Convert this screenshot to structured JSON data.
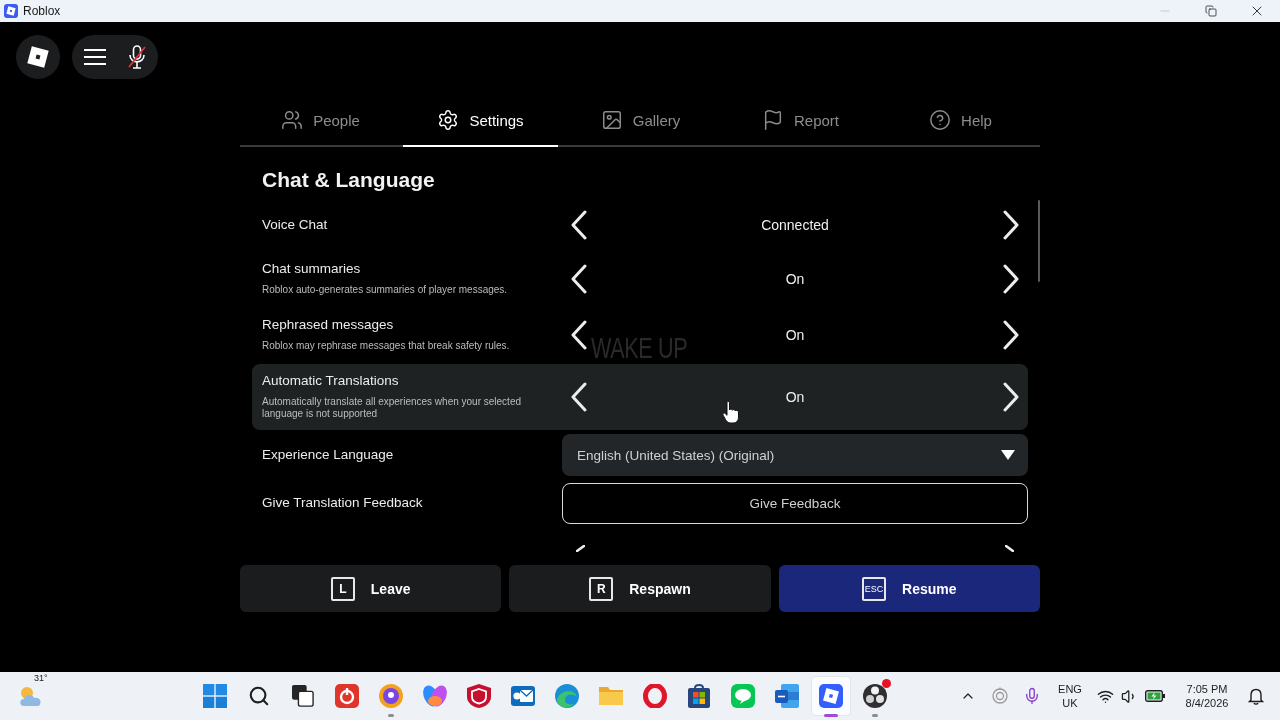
{
  "window": {
    "title": "Roblox",
    "controls": [
      {
        "kind": "minimize",
        "disabled": true
      },
      {
        "kind": "restore",
        "disabled": false
      },
      {
        "kind": "close",
        "disabled": false
      }
    ]
  },
  "voice": {
    "muted": true
  },
  "tabs": [
    {
      "kind": "people",
      "label": "People",
      "selected": false
    },
    {
      "kind": "settings",
      "label": "Settings",
      "selected": true
    },
    {
      "kind": "gallery",
      "label": "Gallery",
      "selected": false
    },
    {
      "kind": "report",
      "label": "Report",
      "selected": false
    },
    {
      "kind": "help",
      "label": "Help",
      "selected": false
    }
  ],
  "section": {
    "title": "Chat & Language"
  },
  "settings": [
    {
      "kind": "selector",
      "label": "Voice Chat",
      "value": "Connected",
      "hovered": false
    },
    {
      "kind": "selector",
      "label": "Chat summaries",
      "description": "Roblox auto-generates summaries of player messages.",
      "value": "On",
      "hovered": false
    },
    {
      "kind": "selector",
      "label": "Rephrased messages",
      "description": "Roblox may rephrase messages that break safety rules.",
      "value": "On",
      "hovered": false
    },
    {
      "kind": "selector",
      "label": "Automatic Translations",
      "description": "Automatically translate all experiences when your selected language is not supported",
      "value": "On",
      "hovered": true
    },
    {
      "kind": "dropdown",
      "label": "Experience Language",
      "value": "English (United States) (Original)",
      "hovered": false
    },
    {
      "kind": "button",
      "label": "Give Translation Feedback",
      "button": "Give Feedback",
      "hovered": false
    },
    {
      "kind": "cut",
      "hovered": false
    }
  ],
  "background_text": "WAKE UP",
  "actions": [
    {
      "key": "L",
      "label": "Leave",
      "primary": false
    },
    {
      "key": "R",
      "label": "Respawn",
      "primary": false
    },
    {
      "key": "ESC",
      "label": "Resume",
      "primary": true
    }
  ],
  "taskbar": {
    "weather": {
      "temperature": "31°"
    },
    "apps": [
      {
        "kind": "tiles",
        "selected": false,
        "running": false,
        "alert": false
      },
      {
        "kind": "search",
        "selected": false,
        "running": false,
        "alert": false
      },
      {
        "kind": "squares",
        "selected": false,
        "running": false,
        "alert": false
      },
      {
        "kind": "badge",
        "selected": false,
        "running": false,
        "alert": false
      },
      {
        "kind": "circle",
        "selected": false,
        "running": true,
        "alert": false
      },
      {
        "kind": "swirl",
        "selected": false,
        "running": false,
        "alert": false
      },
      {
        "kind": "shield",
        "selected": false,
        "running": false,
        "alert": false
      },
      {
        "kind": "mail",
        "selected": false,
        "running": false,
        "alert": false
      },
      {
        "kind": "wave",
        "selected": false,
        "running": false,
        "alert": false
      },
      {
        "kind": "folder",
        "selected": false,
        "running": false,
        "alert": false
      },
      {
        "kind": "ring",
        "selected": false,
        "running": false,
        "alert": false
      },
      {
        "kind": "grid",
        "selected": false,
        "running": false,
        "alert": false
      },
      {
        "kind": "bubble",
        "selected": false,
        "running": false,
        "alert": false
      },
      {
        "kind": "document",
        "selected": false,
        "running": false,
        "alert": false
      },
      {
        "kind": "logo",
        "selected": true,
        "running": true,
        "alert": false
      },
      {
        "kind": "lens",
        "selected": false,
        "running": true,
        "alert": true
      }
    ],
    "tray": {
      "language": "ENG",
      "region": "UK",
      "time": "7:05 PM",
      "date": "8/4/2026"
    }
  }
}
